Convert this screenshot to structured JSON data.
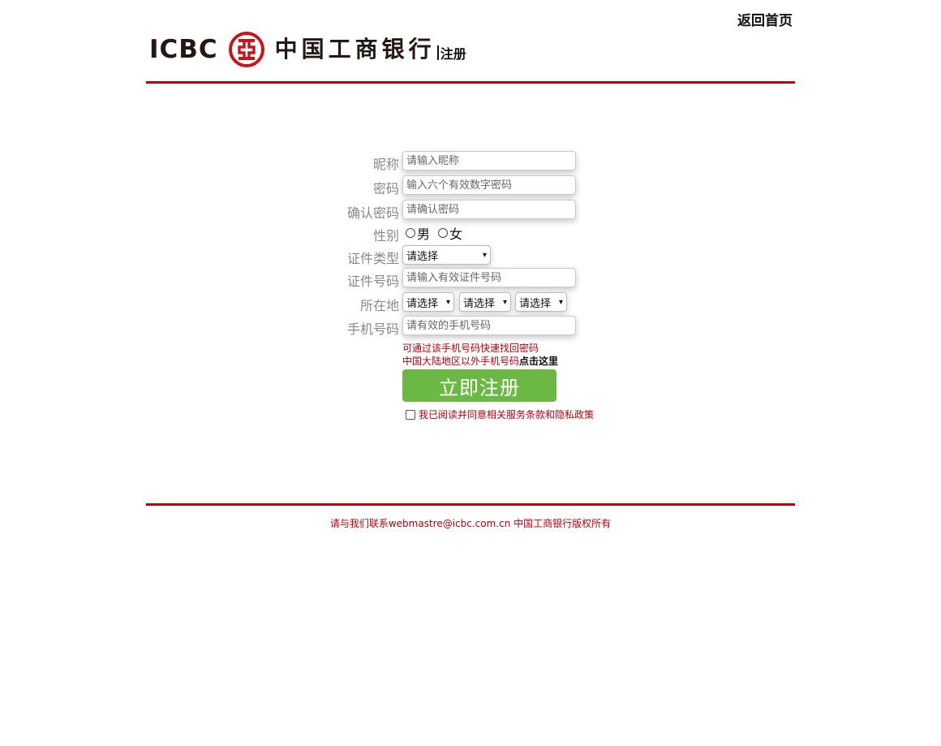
{
  "header": {
    "home_link": "返回首页",
    "logo_en": "ICBC",
    "logo_cn": "中国工商银行",
    "logo_sub": "注册",
    "logo_mark_icon": "icbc-logo-mark-icon"
  },
  "form": {
    "nickname": {
      "label": "昵称",
      "placeholder": "请输入昵称"
    },
    "password": {
      "label": "密码",
      "placeholder": "输入六个有效数字密码"
    },
    "confirm_password": {
      "label": "确认密码",
      "placeholder": "请确认密码"
    },
    "gender": {
      "label": "性别",
      "options": [
        "男",
        "女"
      ]
    },
    "id_type": {
      "label": "证件类型",
      "selected": "请选择"
    },
    "id_number": {
      "label": "证件号码",
      "placeholder": "请输入有效证件号码"
    },
    "location": {
      "label": "所在地",
      "province": "请选择",
      "city": "请选择",
      "district": "请选择"
    },
    "phone": {
      "label": "手机号码",
      "placeholder": "请有效的手机号码"
    },
    "hint_recover": "可通过该手机号码快速找回密码",
    "hint_foreign": "中国大陆地区以外手机号码",
    "hint_foreign_link": "点击这里",
    "submit": "立即注册",
    "agree": "我已阅读并同意相关服务条款和隐私政策"
  },
  "footer": {
    "text": "请与我们联系webmastre@icbc.com.cn 中国工商银行版权所有"
  },
  "colors": {
    "brand_red": "#b7000c",
    "button_green": "#6cb844"
  }
}
